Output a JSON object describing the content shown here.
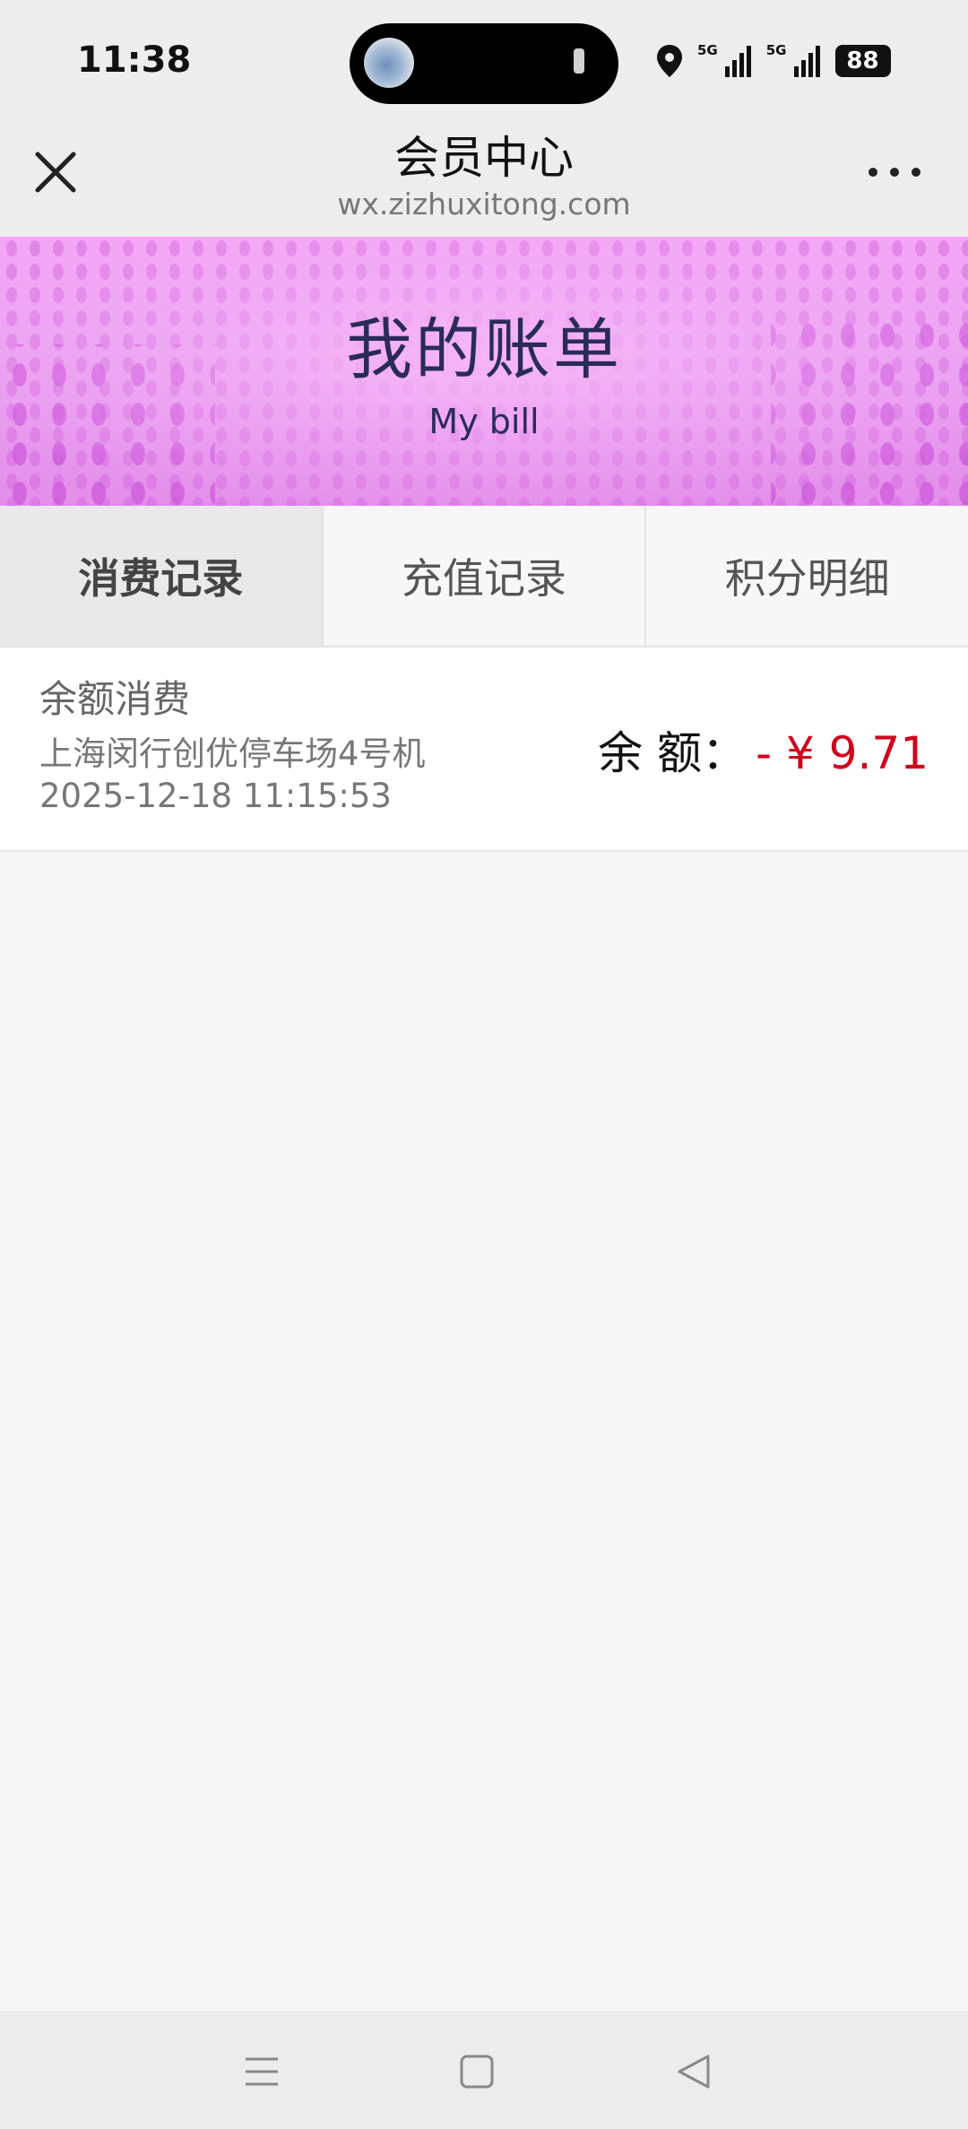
{
  "status_bar": {
    "time": "11:38",
    "network_1": "5G",
    "network_2": "5G",
    "battery": "88"
  },
  "header": {
    "title": "会员中心",
    "url": "wx.zizhuxitong.com"
  },
  "banner": {
    "title": "我的账单",
    "subtitle": "My bill"
  },
  "tabs": [
    {
      "label": "消费记录",
      "active": true
    },
    {
      "label": "充值记录",
      "active": false
    },
    {
      "label": "积分明细",
      "active": false
    }
  ],
  "records": [
    {
      "type": "余额消费",
      "place": "上海闵行创优停车场4号机",
      "datetime": "2025-12-18 11:15:53",
      "amount_label": "余 额：",
      "amount_value": "- ¥ 9.71"
    }
  ],
  "colors": {
    "accent_amount": "#d0021b",
    "banner_text": "#2a2b5a",
    "banner_bg": "#eba2f2"
  },
  "icons": [
    "close-icon",
    "more-icon",
    "location-icon",
    "signal-icon",
    "battery-icon",
    "menu-icon",
    "home-icon",
    "back-icon"
  ]
}
